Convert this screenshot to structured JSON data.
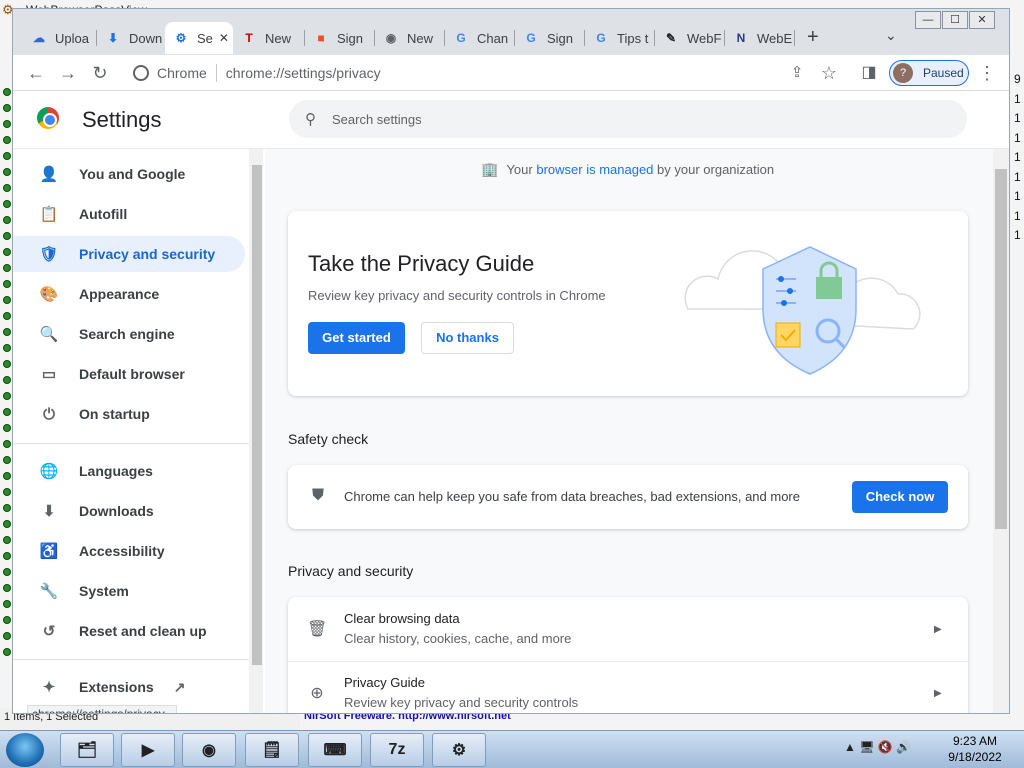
{
  "background_app": {
    "title": "WebBrowserPassView",
    "right_numbers": [
      "9",
      "1",
      "1",
      "1",
      "1",
      "1",
      "1",
      "1",
      "1"
    ],
    "status_text": "1 Items, 1 Selected",
    "status_link": "NirSoft Freeware.  http://www.nirsoft.net"
  },
  "window_controls": {
    "minimize": "—",
    "maximize": "☐",
    "close": "✕"
  },
  "tabs": [
    {
      "label": "Uploa",
      "icon": "upload-cloud-icon",
      "glyph": "☁",
      "color": "#3367d6"
    },
    {
      "label": "Down",
      "icon": "download-icon",
      "glyph": "⬇",
      "color": "#1a73e8"
    },
    {
      "label": "Se",
      "icon": "settings-gear-icon",
      "glyph": "⚙",
      "color": "#1a73e8"
    },
    {
      "label": "New",
      "icon": "tesla-icon",
      "glyph": "T",
      "color": "#cc0000"
    },
    {
      "label": "Sign",
      "icon": "microsoft-icon",
      "glyph": "■",
      "color": "#f25022"
    },
    {
      "label": "New",
      "icon": "chrome-icon",
      "glyph": "◉",
      "color": "#5f6368"
    },
    {
      "label": "Chan",
      "icon": "google-icon",
      "glyph": "G",
      "color": "#4285f4"
    },
    {
      "label": "Sign",
      "icon": "google-icon",
      "glyph": "G",
      "color": "#4285f4"
    },
    {
      "label": "Tips t",
      "icon": "google-icon",
      "glyph": "G",
      "color": "#4285f4"
    },
    {
      "label": "WebF",
      "icon": "feather-icon",
      "glyph": "✎",
      "color": "#202124"
    },
    {
      "label": "WebE",
      "icon": "webe-icon",
      "glyph": "N",
      "color": "#2b3a8c"
    }
  ],
  "active_tab_close": "✕",
  "new_tab": "+",
  "tab_search": "⌄",
  "toolbar": {
    "back": "←",
    "forward": "→",
    "reload": "↻",
    "site_name": "Chrome",
    "url": "chrome://settings/privacy",
    "share": "⇪",
    "star": "☆",
    "sidepanel": "◨",
    "profile_initial": "?",
    "profile_status": "Paused",
    "menu": "⋮"
  },
  "settings": {
    "title": "Settings",
    "search_placeholder": "Search settings",
    "search_glyph": "⚲"
  },
  "sidebar": {
    "items": [
      {
        "label": "You and Google",
        "icon": "person-icon",
        "glyph": "👤"
      },
      {
        "label": "Autofill",
        "icon": "clipboard-icon",
        "glyph": "📋"
      },
      {
        "label": "Privacy and security",
        "icon": "shield-icon",
        "glyph": "🛡"
      },
      {
        "label": "Appearance",
        "icon": "palette-icon",
        "glyph": "🎨"
      },
      {
        "label": "Search engine",
        "icon": "search-icon",
        "glyph": "🔍"
      },
      {
        "label": "Default browser",
        "icon": "browser-icon",
        "glyph": "▭"
      },
      {
        "label": "On startup",
        "icon": "power-icon",
        "glyph": "⏻"
      }
    ],
    "items2": [
      {
        "label": "Languages",
        "icon": "globe-icon",
        "glyph": "🌐"
      },
      {
        "label": "Downloads",
        "icon": "download-icon",
        "glyph": "⬇"
      },
      {
        "label": "Accessibility",
        "icon": "accessibility-icon",
        "glyph": "♿"
      },
      {
        "label": "System",
        "icon": "wrench-icon",
        "glyph": "🔧"
      },
      {
        "label": "Reset and clean up",
        "icon": "restore-icon",
        "glyph": "↺"
      }
    ],
    "extensions": {
      "label": "Extensions",
      "icon": "puzzle-icon",
      "glyph": "✦",
      "ext_glyph": "↗"
    }
  },
  "managed": {
    "pre": "Your ",
    "link": "browser is managed",
    "post": " by your organization"
  },
  "privacy_guide": {
    "title": "Take the Privacy Guide",
    "subtitle": "Review key privacy and security controls in Chrome",
    "primary": "Get started",
    "secondary": "No thanks"
  },
  "safety_check": {
    "heading": "Safety check",
    "text": "Chrome can help keep you safe from data breaches, bad extensions, and more",
    "button": "Check now"
  },
  "privacy_section": {
    "heading": "Privacy and security",
    "rows": [
      {
        "title": "Clear browsing data",
        "subtitle": "Clear history, cookies, cache, and more",
        "icon": "trash-icon",
        "glyph": "🗑"
      },
      {
        "title": "Privacy Guide",
        "subtitle": "Review key privacy and security controls",
        "icon": "compass-icon",
        "glyph": "⊕"
      }
    ]
  },
  "status_tooltip": "chrome://settings/privacy",
  "taskbar": {
    "time": "9:23 AM",
    "date": "9/18/2022",
    "items": [
      {
        "icon": "file-explorer-icon",
        "glyph": "🗂"
      },
      {
        "icon": "media-player-icon",
        "glyph": "▶"
      },
      {
        "icon": "chrome-icon",
        "glyph": "◉"
      },
      {
        "icon": "sticky-notes-icon",
        "glyph": "🗒"
      },
      {
        "icon": "keyboard-icon",
        "glyph": "⌨"
      },
      {
        "icon": "7zip-icon",
        "glyph": "7z"
      },
      {
        "icon": "nirsoft-app-icon",
        "glyph": "⚙"
      }
    ],
    "tray": "▲ 🖥 🔇 🔊"
  }
}
